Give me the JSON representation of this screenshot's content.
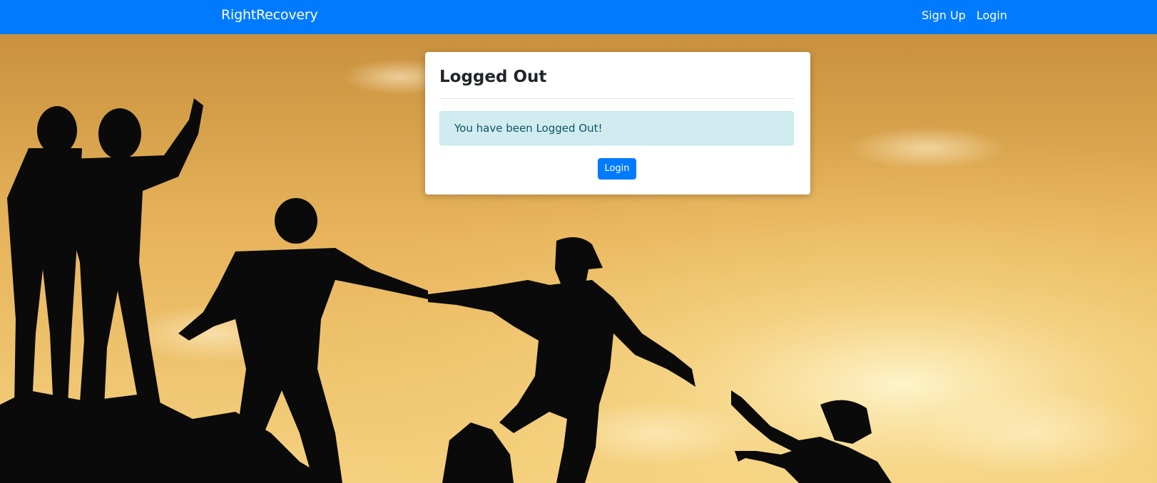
{
  "navbar": {
    "brand": "RightRecovery",
    "links": [
      "Sign Up",
      "Login"
    ],
    "color": "#007bff"
  },
  "card": {
    "title": "Logged Out",
    "alert_text": "You have been Logged Out!",
    "button_label": "Login"
  },
  "background": {
    "description_icon": "silhouette-people-helping-icon",
    "sky_colors": [
      "#c48a3a",
      "#f0c56a",
      "#f9e4a6"
    ]
  }
}
